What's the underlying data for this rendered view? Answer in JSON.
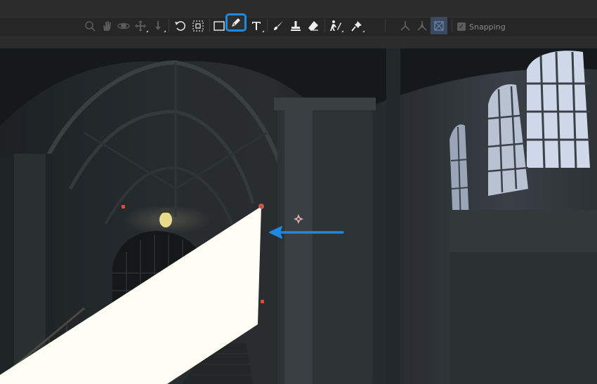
{
  "toolbar": {
    "snapping_label": "Snapping",
    "snapping_checked": true,
    "active_tool": "pen",
    "tools": [
      {
        "id": "zoom",
        "icon": "zoom-icon",
        "enabled": false
      },
      {
        "id": "hand",
        "icon": "hand-icon",
        "enabled": false
      },
      {
        "id": "orbit",
        "icon": "orbit-icon",
        "enabled": false
      },
      {
        "id": "move",
        "icon": "move-icon",
        "enabled": false
      },
      {
        "id": "push",
        "icon": "push-icon",
        "enabled": false
      },
      {
        "id": "rotate",
        "icon": "rotate-icon",
        "enabled": true
      },
      {
        "id": "scale",
        "icon": "scale-icon",
        "enabled": true
      },
      {
        "id": "rectangle",
        "icon": "rectangle-icon",
        "enabled": true
      },
      {
        "id": "pen",
        "icon": "pen-tool-icon",
        "enabled": true
      },
      {
        "id": "text",
        "icon": "text-tool-icon",
        "enabled": true
      },
      {
        "id": "brush",
        "icon": "brush-icon",
        "enabled": true
      },
      {
        "id": "stamp",
        "icon": "clone-stamp-icon",
        "enabled": true
      },
      {
        "id": "eraser",
        "icon": "eraser-icon",
        "enabled": true
      },
      {
        "id": "puppet",
        "icon": "puppet-icon",
        "enabled": true
      },
      {
        "id": "pin",
        "icon": "pin-icon",
        "enabled": true
      },
      {
        "id": "axis-local",
        "icon": "local-axis-icon",
        "enabled": false
      },
      {
        "id": "axis-world",
        "icon": "world-axis-icon",
        "enabled": false
      },
      {
        "id": "axis-view",
        "icon": "view-axis-icon",
        "enabled": false
      }
    ]
  },
  "colors": {
    "highlight": "#1e88e5",
    "arrow": "#1e88e5",
    "mask_fill": "#fffdf4",
    "vertex": "#d94a3a"
  }
}
